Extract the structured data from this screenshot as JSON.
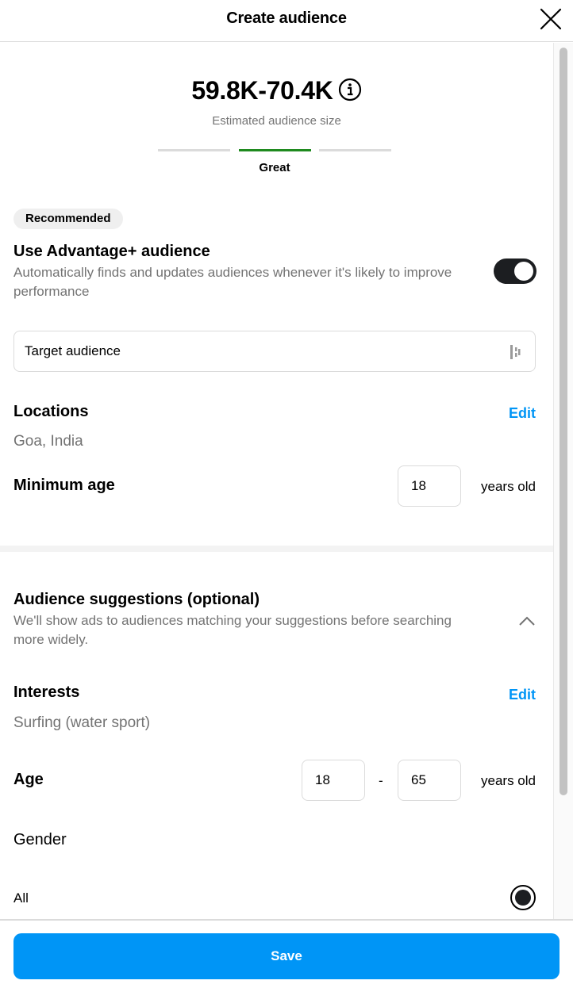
{
  "header": {
    "title": "Create audience",
    "close_icon": "close-icon"
  },
  "estimate": {
    "value": "59.8K-70.4K",
    "info_icon": "info-icon",
    "label": "Estimated audience size",
    "meter": {
      "segments": 3,
      "active_segment": 2,
      "active_color": "#1f8a1f",
      "inactive_color": "#dbdbdb",
      "label": "Great"
    }
  },
  "advantage": {
    "badge": "Recommended",
    "title": "Use Advantage+ audience",
    "description": "Automatically finds and updates audiences whenever it's likely to improve performance",
    "toggle_on": true
  },
  "target_audience": {
    "label": "Target audience",
    "icon": "audience-bars-icon"
  },
  "locations": {
    "title": "Locations",
    "edit_label": "Edit",
    "value": "Goa, India"
  },
  "minimum_age": {
    "title": "Minimum age",
    "value": "18",
    "unit": "years old"
  },
  "suggestions": {
    "title": "Audience suggestions (optional)",
    "description": "We'll show ads to audiences matching your suggestions before searching more widely.",
    "expanded": true,
    "chevron_icon": "chevron-up-icon"
  },
  "interests": {
    "title": "Interests",
    "edit_label": "Edit",
    "value": "Surfing (water sport)"
  },
  "age": {
    "title": "Age",
    "min": "18",
    "separator": "-",
    "max": "65",
    "unit": "years old"
  },
  "gender": {
    "title": "Gender",
    "options": [
      {
        "label": "All",
        "selected": true
      }
    ]
  },
  "footer": {
    "save_label": "Save"
  },
  "colors": {
    "accent": "#0095f6",
    "meter_great": "#1f8a1f",
    "toggle_on": "#1c1e21",
    "secondary_text": "#737373"
  }
}
